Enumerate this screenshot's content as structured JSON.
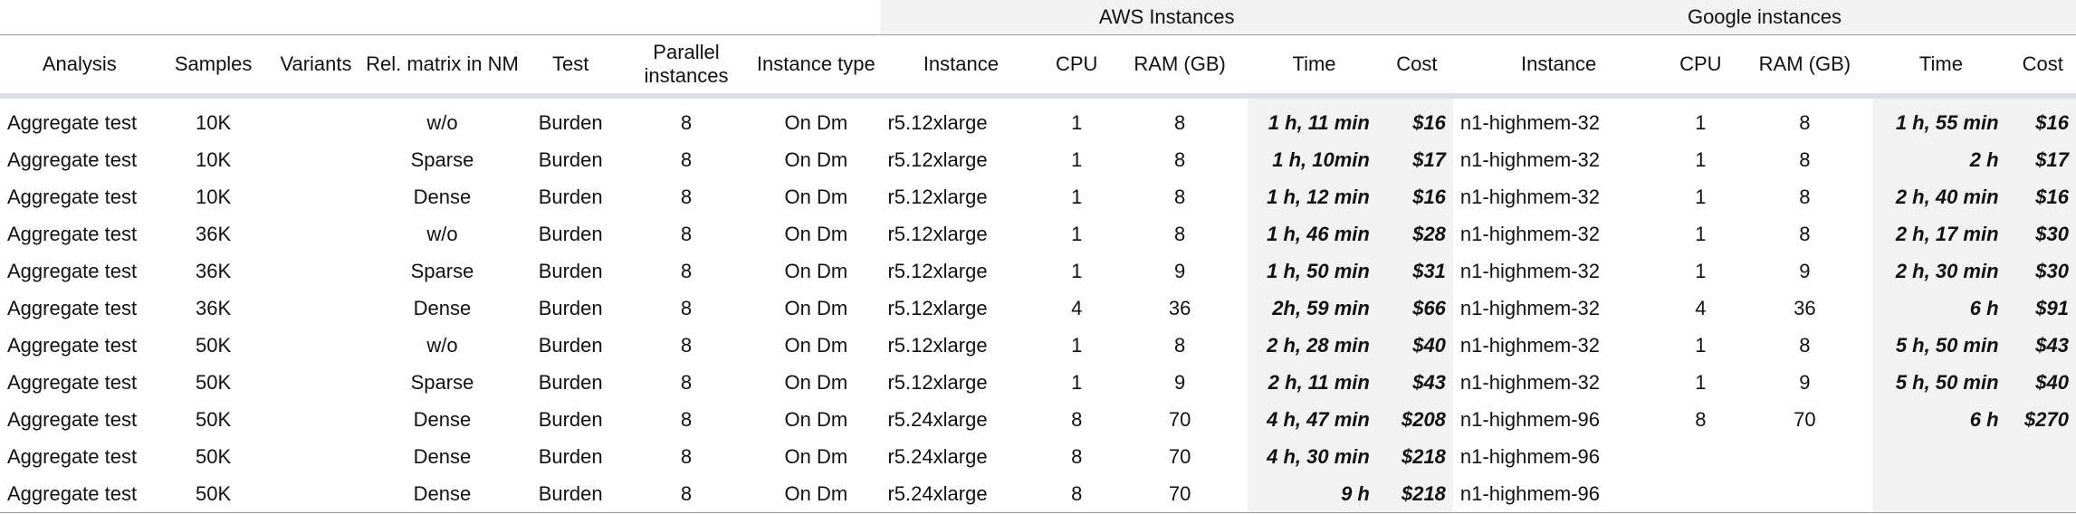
{
  "groups": {
    "aws": "AWS Instances",
    "google": "Google instances"
  },
  "columns": {
    "analysis": "Analysis",
    "samples": "Samples",
    "variants": "Variants",
    "rel_matrix": "Rel. matrix in NM",
    "test": "Test",
    "parallel": "Parallel instances",
    "instance_type": "Instance type",
    "aws_instance": "Instance",
    "aws_cpu": "CPU",
    "aws_ram": "RAM (GB)",
    "aws_time": "Time",
    "aws_cost": "Cost",
    "g_instance": "Instance",
    "g_cpu": "CPU",
    "g_ram": "RAM (GB)",
    "g_time": "Time",
    "g_cost": "Cost"
  },
  "rows": [
    [
      "Aggregate test",
      "10K",
      "",
      "w/o",
      "Burden",
      "8",
      "On Dm",
      "r5.12xlarge",
      "1",
      "8",
      "1 h, 11 min",
      "$16",
      "n1-highmem-32",
      "1",
      "8",
      "1 h, 55 min",
      "$16"
    ],
    [
      "Aggregate test",
      "10K",
      "",
      "Sparse",
      "Burden",
      "8",
      "On Dm",
      "r5.12xlarge",
      "1",
      "8",
      "1 h, 10min",
      "$17",
      "n1-highmem-32",
      "1",
      "8",
      "2 h",
      "$17"
    ],
    [
      "Aggregate test",
      "10K",
      "",
      "Dense",
      "Burden",
      "8",
      "On Dm",
      "r5.12xlarge",
      "1",
      "8",
      "1 h, 12 min",
      "$16",
      "n1-highmem-32",
      "1",
      "8",
      "2 h, 40 min",
      "$16"
    ],
    [
      "Aggregate test",
      "36K",
      "",
      "w/o",
      "Burden",
      "8",
      "On Dm",
      "r5.12xlarge",
      "1",
      "8",
      "1 h, 46 min",
      "$28",
      "n1-highmem-32",
      "1",
      "8",
      "2 h, 17 min",
      "$30"
    ],
    [
      "Aggregate test",
      "36K",
      "",
      "Sparse",
      "Burden",
      "8",
      "On Dm",
      "r5.12xlarge",
      "1",
      "9",
      "1 h, 50 min",
      "$31",
      "n1-highmem-32",
      "1",
      "9",
      "2 h, 30 min",
      "$30"
    ],
    [
      "Aggregate test",
      "36K",
      "",
      "Dense",
      "Burden",
      "8",
      "On Dm",
      "r5.12xlarge",
      "4",
      "36",
      "2h, 59 min",
      "$66",
      "n1-highmem-32",
      "4",
      "36",
      "6 h",
      "$91"
    ],
    [
      "Aggregate test",
      "50K",
      "",
      "w/o",
      "Burden",
      "8",
      "On Dm",
      "r5.12xlarge",
      "1",
      "8",
      "2 h, 28 min",
      "$40",
      "n1-highmem-32",
      "1",
      "8",
      "5 h, 50 min",
      "$43"
    ],
    [
      "Aggregate test",
      "50K",
      "",
      "Sparse",
      "Burden",
      "8",
      "On Dm",
      "r5.12xlarge",
      "1",
      "9",
      "2 h, 11 min",
      "$43",
      "n1-highmem-32",
      "1",
      "9",
      "5 h, 50 min",
      "$40"
    ],
    [
      "Aggregate test",
      "50K",
      "",
      "Dense",
      "Burden",
      "8",
      "On Dm",
      "r5.24xlarge",
      "8",
      "70",
      "4 h, 47 min",
      "$208",
      "n1-highmem-96",
      "8",
      "70",
      "6 h",
      "$270"
    ],
    [
      "Aggregate test",
      "50K",
      "",
      "Dense",
      "Burden",
      "8",
      "On Dm",
      "r5.24xlarge",
      "8",
      "70",
      "4 h, 30 min",
      "$218",
      "n1-highmem-96",
      "",
      "",
      "",
      ""
    ],
    [
      "Aggregate test",
      "50K",
      "",
      "Dense",
      "Burden",
      "8",
      "On Dm",
      "r5.24xlarge",
      "8",
      "70",
      "9 h",
      "$218",
      "n1-highmem-96",
      "",
      "",
      "",
      ""
    ]
  ]
}
